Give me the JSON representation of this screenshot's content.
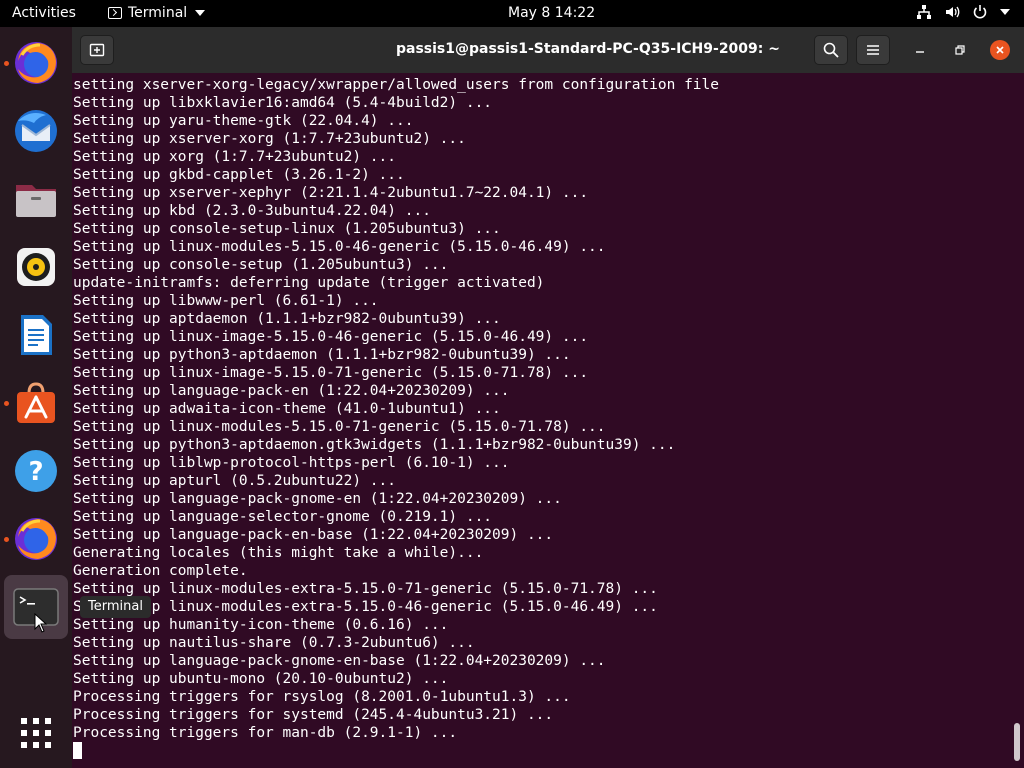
{
  "topbar": {
    "activities": "Activities",
    "app_name": "Terminal",
    "clock": "May 8  14:22"
  },
  "dock": {
    "items": [
      {
        "name": "firefox",
        "running": true
      },
      {
        "name": "thunderbird",
        "running": false
      },
      {
        "name": "files",
        "running": false
      },
      {
        "name": "rhythmbox",
        "running": false
      },
      {
        "name": "libreoffice-writer",
        "running": false
      },
      {
        "name": "ubuntu-software",
        "running": true
      },
      {
        "name": "help",
        "running": false
      },
      {
        "name": "firefox",
        "running": true
      },
      {
        "name": "terminal",
        "running": true
      }
    ],
    "tooltip": "Terminal"
  },
  "window": {
    "title": "passis1@passis1-Standard-PC-Q35-ICH9-2009: ~"
  },
  "terminal": {
    "lines": [
      "setting xserver-xorg-legacy/xwrapper/allowed_users from configuration file",
      "Setting up libxklavier16:amd64 (5.4-4build2) ...",
      "Setting up yaru-theme-gtk (22.04.4) ...",
      "Setting up xserver-xorg (1:7.7+23ubuntu2) ...",
      "Setting up xorg (1:7.7+23ubuntu2) ...",
      "Setting up gkbd-capplet (3.26.1-2) ...",
      "Setting up xserver-xephyr (2:21.1.4-2ubuntu1.7~22.04.1) ...",
      "Setting up kbd (2.3.0-3ubuntu4.22.04) ...",
      "Setting up console-setup-linux (1.205ubuntu3) ...",
      "Setting up linux-modules-5.15.0-46-generic (5.15.0-46.49) ...",
      "Setting up console-setup (1.205ubuntu3) ...",
      "update-initramfs: deferring update (trigger activated)",
      "Setting up libwww-perl (6.61-1) ...",
      "Setting up aptdaemon (1.1.1+bzr982-0ubuntu39) ...",
      "Setting up linux-image-5.15.0-46-generic (5.15.0-46.49) ...",
      "Setting up python3-aptdaemon (1.1.1+bzr982-0ubuntu39) ...",
      "Setting up linux-image-5.15.0-71-generic (5.15.0-71.78) ...",
      "Setting up language-pack-en (1:22.04+20230209) ...",
      "Setting up adwaita-icon-theme (41.0-1ubuntu1) ...",
      "Setting up linux-modules-5.15.0-71-generic (5.15.0-71.78) ...",
      "Setting up python3-aptdaemon.gtk3widgets (1.1.1+bzr982-0ubuntu39) ...",
      "Setting up liblwp-protocol-https-perl (6.10-1) ...",
      "Setting up apturl (0.5.2ubuntu22) ...",
      "Setting up language-pack-gnome-en (1:22.04+20230209) ...",
      "Setting up language-selector-gnome (0.219.1) ...",
      "Setting up language-pack-en-base (1:22.04+20230209) ...",
      "Generating locales (this might take a while)...",
      "Generation complete.",
      "Setting up linux-modules-extra-5.15.0-71-generic (5.15.0-71.78) ...",
      "Setting up linux-modules-extra-5.15.0-46-generic (5.15.0-46.49) ...",
      "Setting up humanity-icon-theme (0.6.16) ...",
      "Setting up nautilus-share (0.7.3-2ubuntu6) ...",
      "Setting up language-pack-gnome-en-base (1:22.04+20230209) ...",
      "Setting up ubuntu-mono (20.10-0ubuntu2) ...",
      "Processing triggers for rsyslog (8.2001.0-1ubuntu1.3) ...",
      "Processing triggers for systemd (245.4-4ubuntu3.21) ...",
      "Processing triggers for man-db (2.9.1-1) ..."
    ]
  },
  "colors": {
    "terminal_bg": "#300a24",
    "accent": "#e95420",
    "dock_bg": "#26181f",
    "headerbar_bg": "#2c2c2c"
  }
}
